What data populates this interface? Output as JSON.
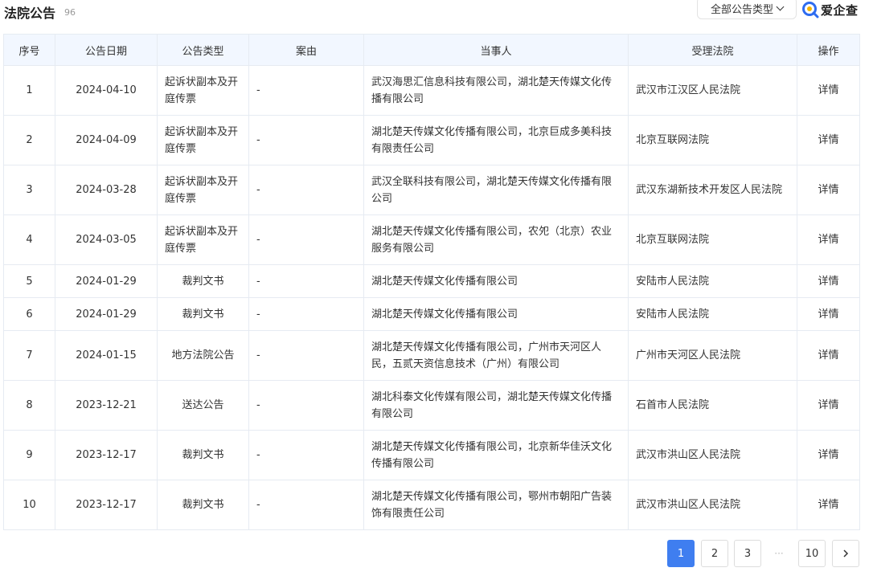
{
  "header": {
    "title": "法院公告",
    "count": "96",
    "type_filter": "全部公告类型",
    "logo_text": "爱企查",
    "colors": {
      "accent": "#3f7ef0",
      "link": "#2a6fdb",
      "header_bg": "#f2f7ff"
    }
  },
  "table": {
    "columns": [
      "序号",
      "公告日期",
      "公告类型",
      "案由",
      "当事人",
      "受理法院",
      "操作"
    ],
    "rows": [
      {
        "no": "1",
        "date": "2024-04-10",
        "type": "起诉状副本及开庭传票",
        "cause": "-",
        "parties": "武汉海思汇信息科技有限公司，湖北楚天传媒文化传播有限公司",
        "court": "武汉市江汉区人民法院",
        "action": "详情"
      },
      {
        "no": "2",
        "date": "2024-04-09",
        "type": "起诉状副本及开庭传票",
        "cause": "-",
        "parties": "湖北楚天传媒文化传播有限公司，北京巨成多美科技有限责任公司",
        "court": "北京互联网法院",
        "action": "详情"
      },
      {
        "no": "3",
        "date": "2024-03-28",
        "type": "起诉状副本及开庭传票",
        "cause": "-",
        "parties": "武汉全联科技有限公司，湖北楚天传媒文化传播有限公司",
        "court": "武汉东湖新技术开发区人民法院",
        "action": "详情"
      },
      {
        "no": "4",
        "date": "2024-03-05",
        "type": "起诉状副本及开庭传票",
        "cause": "-",
        "parties": "湖北楚天传媒文化传播有限公司，农夗（北京）农业服务有限公司",
        "court": "北京互联网法院",
        "action": "详情"
      },
      {
        "no": "5",
        "date": "2024-01-29",
        "type": "裁判文书",
        "cause": "-",
        "parties": "湖北楚天传媒文化传播有限公司",
        "court": "安陆市人民法院",
        "action": "详情"
      },
      {
        "no": "6",
        "date": "2024-01-29",
        "type": "裁判文书",
        "cause": "-",
        "parties": "湖北楚天传媒文化传播有限公司",
        "court": "安陆市人民法院",
        "action": "详情"
      },
      {
        "no": "7",
        "date": "2024-01-15",
        "type": "地方法院公告",
        "cause": "-",
        "parties": "湖北楚天传媒文化传播有限公司，广州市天河区人民，五贰天资信息技术（广州）有限公司",
        "court": "广州市天河区人民法院",
        "action": "详情"
      },
      {
        "no": "8",
        "date": "2023-12-21",
        "type": "送达公告",
        "cause": "-",
        "parties": "湖北科泰文化传媒有限公司，湖北楚天传媒文化传播有限公司",
        "court": "石首市人民法院",
        "action": "详情"
      },
      {
        "no": "9",
        "date": "2023-12-17",
        "type": "裁判文书",
        "cause": "-",
        "parties": "湖北楚天传媒文化传播有限公司，北京新华佳沃文化传播有限公司",
        "court": "武汉市洪山区人民法院",
        "action": "详情"
      },
      {
        "no": "10",
        "date": "2023-12-17",
        "type": "裁判文书",
        "cause": "-",
        "parties": "湖北楚天传媒文化传播有限公司，鄂州市朝阳广告装饰有限责任公司",
        "court": "武汉市洪山区人民法院",
        "action": "详情"
      }
    ]
  },
  "pagination": {
    "pages": [
      "1",
      "2",
      "3"
    ],
    "ellipsis": "···",
    "last": "10",
    "current": "1"
  }
}
